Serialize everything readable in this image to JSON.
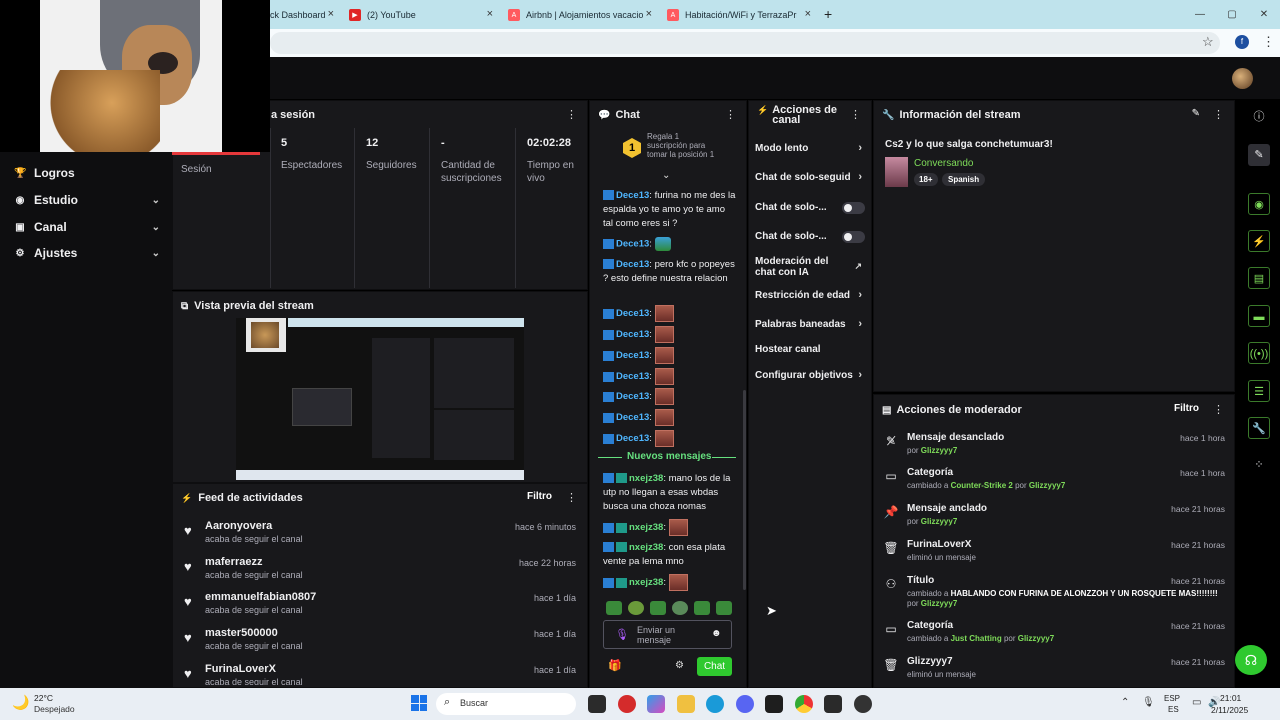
{
  "browser": {
    "tabs": [
      {
        "label": "ck Dashboard"
      },
      {
        "label": "(2) YouTube"
      },
      {
        "label": "Airbnb | Alojamientos vacacion"
      },
      {
        "label": "Habitación/WiFi y TerrazaPrivad"
      }
    ],
    "new_tab": "+",
    "window_controls": [
      "—",
      "▢",
      "✕"
    ],
    "profile_initial": "f"
  },
  "sidebar": {
    "items": [
      {
        "label": "Logros",
        "icon": "trophy-icon"
      },
      {
        "label": "Estudio",
        "icon": "studio-icon"
      },
      {
        "label": "Canal",
        "icon": "channel-icon"
      },
      {
        "label": "Ajustes",
        "icon": "gear-icon"
      }
    ]
  },
  "session": {
    "title": "a sesión",
    "label": "Sesión",
    "stats": [
      {
        "value": "5",
        "label": "Espectadores"
      },
      {
        "value": "12",
        "label": "Seguidores"
      },
      {
        "value": "-",
        "label": "Cantidad de suscripciones"
      },
      {
        "value": "02:02:28",
        "label": "Tiempo en vivo"
      }
    ]
  },
  "preview": {
    "title": "Vista previa del stream"
  },
  "feed": {
    "title": "Feed de actividades",
    "filter": "Filtro",
    "items": [
      {
        "name": "Aaronyovera",
        "sub": "acaba de seguir el canal",
        "time": "hace 6 minutos"
      },
      {
        "name": "maferraezz",
        "sub": "acaba de seguir el canal",
        "time": "hace 22 horas"
      },
      {
        "name": "emmanuelfabian0807",
        "sub": "acaba de seguir el canal",
        "time": "hace 1 día"
      },
      {
        "name": "master500000",
        "sub": "acaba de seguir el canal",
        "time": "hace 1 día"
      },
      {
        "name": "FurinaLoverX",
        "sub": "acaba de seguir el canal",
        "time": "hace 1 día"
      }
    ]
  },
  "chat": {
    "title": "Chat",
    "gift_count": "1",
    "gift_text": "Regala 1 suscripción para tomar la posición 1",
    "new_messages": "Nuevos mensajes",
    "input_placeholder": "Enviar un mensaje",
    "send_label": "Chat",
    "messages": [
      {
        "user": "Dece13",
        "text": "furina no me des la espalda yo te amo yo te amo tal como eres si ?"
      },
      {
        "user": "Dece13",
        "text": ""
      },
      {
        "user": "Dece13",
        "text": "pero kfc o popeyes ? esto define nuestra relacion"
      },
      {
        "user": "Dece13",
        "text": ""
      },
      {
        "user": "Dece13",
        "text": ""
      },
      {
        "user": "Dece13",
        "text": ""
      },
      {
        "user": "Dece13",
        "text": ""
      },
      {
        "user": "Dece13",
        "text": ""
      },
      {
        "user": "Dece13",
        "text": ""
      },
      {
        "user": "Dece13",
        "text": ""
      },
      {
        "user": "nxejz38",
        "text": "mano los de la utp no llegan a esas wbdas busca una choza nomas"
      },
      {
        "user": "nxejz38",
        "text": ""
      },
      {
        "user": "nxejz38",
        "text": "con esa plata vente pa lema mno"
      },
      {
        "user": "nxejz38",
        "text": ""
      }
    ]
  },
  "channel_actions": {
    "title": "Acciones de canal",
    "items": [
      {
        "label": "Modo lento"
      },
      {
        "label": "Chat de solo-seguid"
      },
      {
        "label": "Chat de solo-..."
      },
      {
        "label": "Chat de solo-..."
      },
      {
        "label": "Moderación del chat con IA"
      },
      {
        "label": "Restricción de edad"
      },
      {
        "label": "Palabras baneadas"
      },
      {
        "label": "Hostear canal"
      },
      {
        "label": "Configurar objetivos"
      }
    ]
  },
  "stream_info": {
    "title": "Información del stream",
    "stream_title": "Cs2 y lo que salga conchetumuar3!",
    "category": "Conversando",
    "tags": [
      "18+",
      "Spanish"
    ]
  },
  "mod_actions": {
    "title": "Acciones de moderador",
    "filter": "Filtro",
    "items": [
      {
        "title": "Mensaje desanclado",
        "pre": "por",
        "a": "Glizzyyy7",
        "mid": "",
        "b": "",
        "time": "hace 1 hora",
        "icon": "unpin-icon"
      },
      {
        "title": "Categoría",
        "pre": "cambiado a",
        "a": "Counter-Strike 2",
        "mid": "por",
        "b": "Glizzyyy7",
        "time": "hace 1 hora",
        "icon": "category-icon"
      },
      {
        "title": "Mensaje anclado",
        "pre": "por",
        "a": "Glizzyyy7",
        "mid": "",
        "b": "",
        "time": "hace 21 horas",
        "icon": "pin-icon"
      },
      {
        "title": "FurinaLoverX",
        "pre": "eliminó un mensaje",
        "a": "",
        "mid": "",
        "b": "",
        "time": "hace 21 horas",
        "icon": "trash-icon"
      },
      {
        "title": "Título",
        "pre": "cambiado a",
        "a": "HABLANDO CON FURINA DE ALONZZOH Y UN ROSQUETE MAS!!!!!!!!",
        "mid": "por",
        "b": "Glizzyyy7",
        "time": "hace 21 horas",
        "icon": "title-icon"
      },
      {
        "title": "Categoría",
        "pre": "cambiado a",
        "a": "Just Chatting",
        "mid": "por",
        "b": "Glizzyyy7",
        "time": "hace 21 horas",
        "icon": "category-icon"
      },
      {
        "title": "Glizzyyy7",
        "pre": "eliminó un mensaje",
        "a": "",
        "mid": "",
        "b": "",
        "time": "hace 21 horas",
        "icon": "trash-icon"
      }
    ]
  },
  "taskbar": {
    "weather_temp": "22°C",
    "weather_desc": "Despejado",
    "search": "Buscar",
    "lang1": "ESP",
    "lang2": "ES",
    "time": "21:01",
    "date": "2/11/2025"
  }
}
